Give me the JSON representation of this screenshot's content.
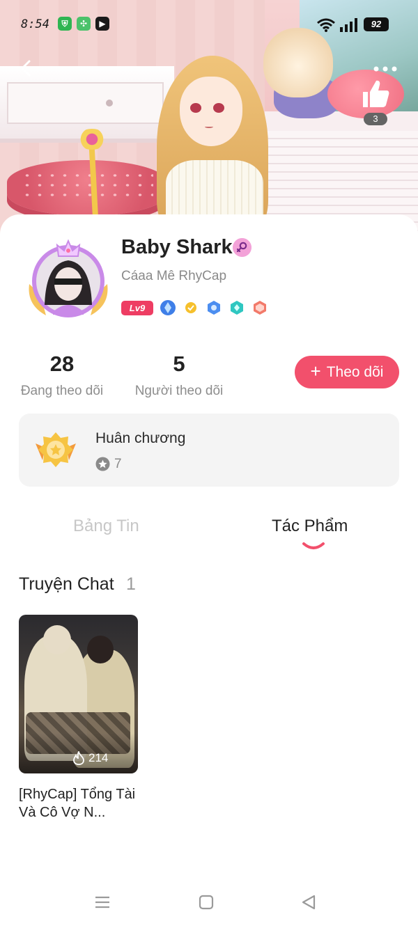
{
  "status_bar": {
    "time": "8:54",
    "battery": "92"
  },
  "hero": {
    "likes": "3"
  },
  "profile": {
    "name": "Baby Shark",
    "subtitle": "Cáaa Mê RhyCap",
    "level": "Lv9"
  },
  "stats": {
    "following_count": "28",
    "following_label": "Đang theo dõi",
    "followers_count": "5",
    "followers_label": "Người theo dõi"
  },
  "follow_button": {
    "label": "Theo dõi",
    "icon": "+"
  },
  "medals": {
    "title": "Huân chương",
    "count": "7"
  },
  "tabs": [
    {
      "label": "Bảng Tin",
      "active": false
    },
    {
      "label": "Tác Phẩm",
      "active": true
    }
  ],
  "section": {
    "title": "Truyện Chat",
    "count": "1"
  },
  "stories": [
    {
      "title": "[RhyCap] Tổng Tài Và Cô Vợ N...",
      "views": "214"
    }
  ],
  "colors": {
    "accent": "#f2506c",
    "level_badge": "#ee3d63",
    "muted": "#8d8d8d"
  }
}
